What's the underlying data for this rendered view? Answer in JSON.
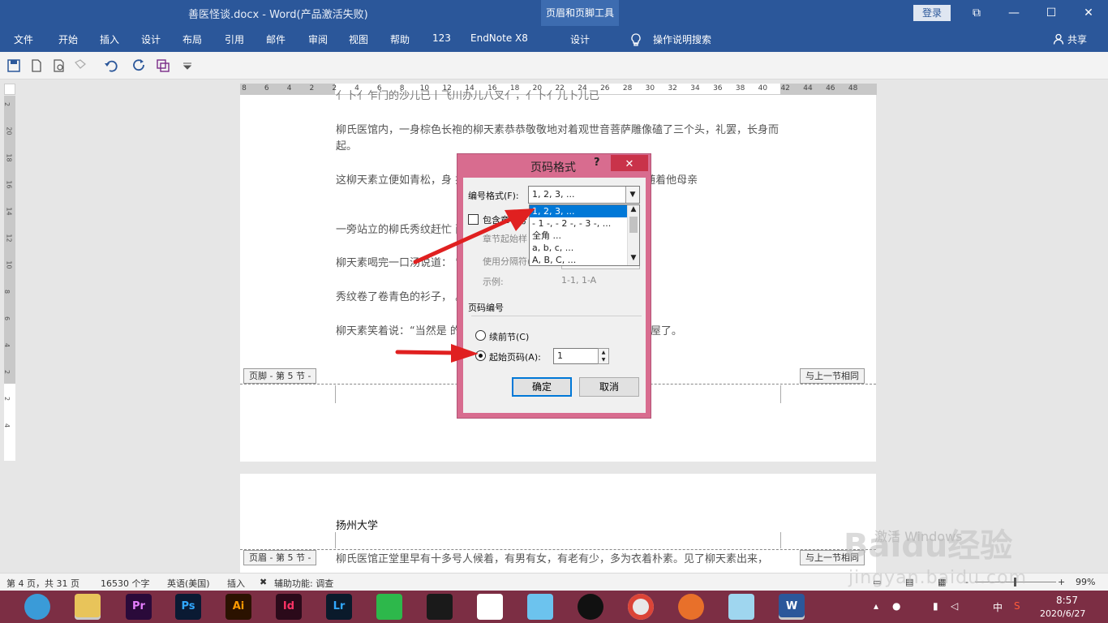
{
  "titlebar": {
    "document": "善医怪谈.docx  -  Word(产品激活失败)",
    "context_tab_group": "页眉和页脚工具",
    "login": "登录",
    "restore": "⧉",
    "minimize": "—",
    "maximize": "☐",
    "close": "✕"
  },
  "ribbon": {
    "tabs": [
      "文件",
      "开始",
      "插入",
      "设计",
      "布局",
      "引用",
      "邮件",
      "审阅",
      "视图",
      "帮助",
      "123",
      "EndNote X8"
    ],
    "context_tab": "设计",
    "tell_me": "操作说明搜索",
    "share": "共享"
  },
  "ruler": {
    "h_numbers": [
      "8",
      "6",
      "4",
      "2",
      "2",
      "4",
      "6",
      "8",
      "10",
      "12",
      "14",
      "16",
      "18",
      "20",
      "22",
      "24",
      "26",
      "28",
      "30",
      "32",
      "34",
      "36",
      "38",
      "40",
      "42",
      "44",
      "46",
      "48"
    ],
    "v_numbers": [
      "2",
      "20",
      "18",
      "16",
      "14",
      "12",
      "10",
      "8",
      "6",
      "4",
      "2",
      "2",
      "4"
    ]
  },
  "document": {
    "paragraphs": [
      "柳氏医馆内，一身棕色长袍的柳天素恭恭敬敬地对着观世音菩萨雕像磕了三个头，礼罢，长身而起。",
      "这柳天素立便如青松，身                                          挂着一抹淡笑，正是远近闻名的善医。他随着他母亲",
      "一旁站立的柳氏秀纹赶忙                                             面再诊病吧。”",
      "柳天素喝完一口汤说道：                                            ”",
      "秀纹卷了卷青色的衫子，                                            。”",
      "柳天素笑着说：“当然是                                           的惜爱。就把碗给了秀纹，理了理袖子便出屋了。"
    ],
    "footer_label": "页脚 - 第 5 节 -",
    "same_as_prev": "与上一节相同",
    "header_label": "页眉 - 第 5 节 -",
    "same_as_prev2": "与上一节相同",
    "page2_header_text": "扬州大学",
    "page2_body": "柳氏医馆正堂里早有十多号人候着，有男有女，有老有少，多为衣着朴素。见了柳天素出来，"
  },
  "dialog": {
    "title": "页码格式",
    "help": "?",
    "close": "✕",
    "number_format_label": "编号格式(F):",
    "number_format_value": "1, 2, 3, ...",
    "format_options": [
      "1, 2, 3, ...",
      "- 1 -, - 2 -, - 3 -, ...",
      "全角 ...",
      "a, b, c, ...",
      "A, B, C, ..."
    ],
    "include_chapter": "包含章节号",
    "chapter_start_style": "章节起始样",
    "use_separator": "使用分隔符(E):",
    "separator_value": "- (连字符)",
    "example_label": "示例:",
    "example_value": "1-1, 1-A",
    "page_numbering": "页码编号",
    "continue_prev": "续前节(C)",
    "start_at": "起始页码(A):",
    "start_value": "1",
    "ok": "确定",
    "cancel": "取消"
  },
  "statusbar": {
    "page": "第 4 页，共 31 页",
    "words": "16530 个字",
    "language": "英语(美国)",
    "insert": "插入",
    "accessibility": "辅助功能: 调查",
    "zoom": "99%",
    "zoom_minus": "-",
    "zoom_plus": "+"
  },
  "taskbar": {
    "apps": [
      "Pr",
      "Ps",
      "Ai",
      "Id",
      "Lr"
    ],
    "time": "8:57",
    "date": "2020/6/27",
    "ime": "中"
  },
  "watermark": {
    "activate": "激活 Windows",
    "brand": "Baidu经验",
    "url": "jingyan.baidu.com"
  },
  "colors": {
    "word_blue": "#2b579a",
    "dialog_pink": "#d86c8f",
    "taskbar": "#7c2e44",
    "arrow_red": "#e02020"
  }
}
